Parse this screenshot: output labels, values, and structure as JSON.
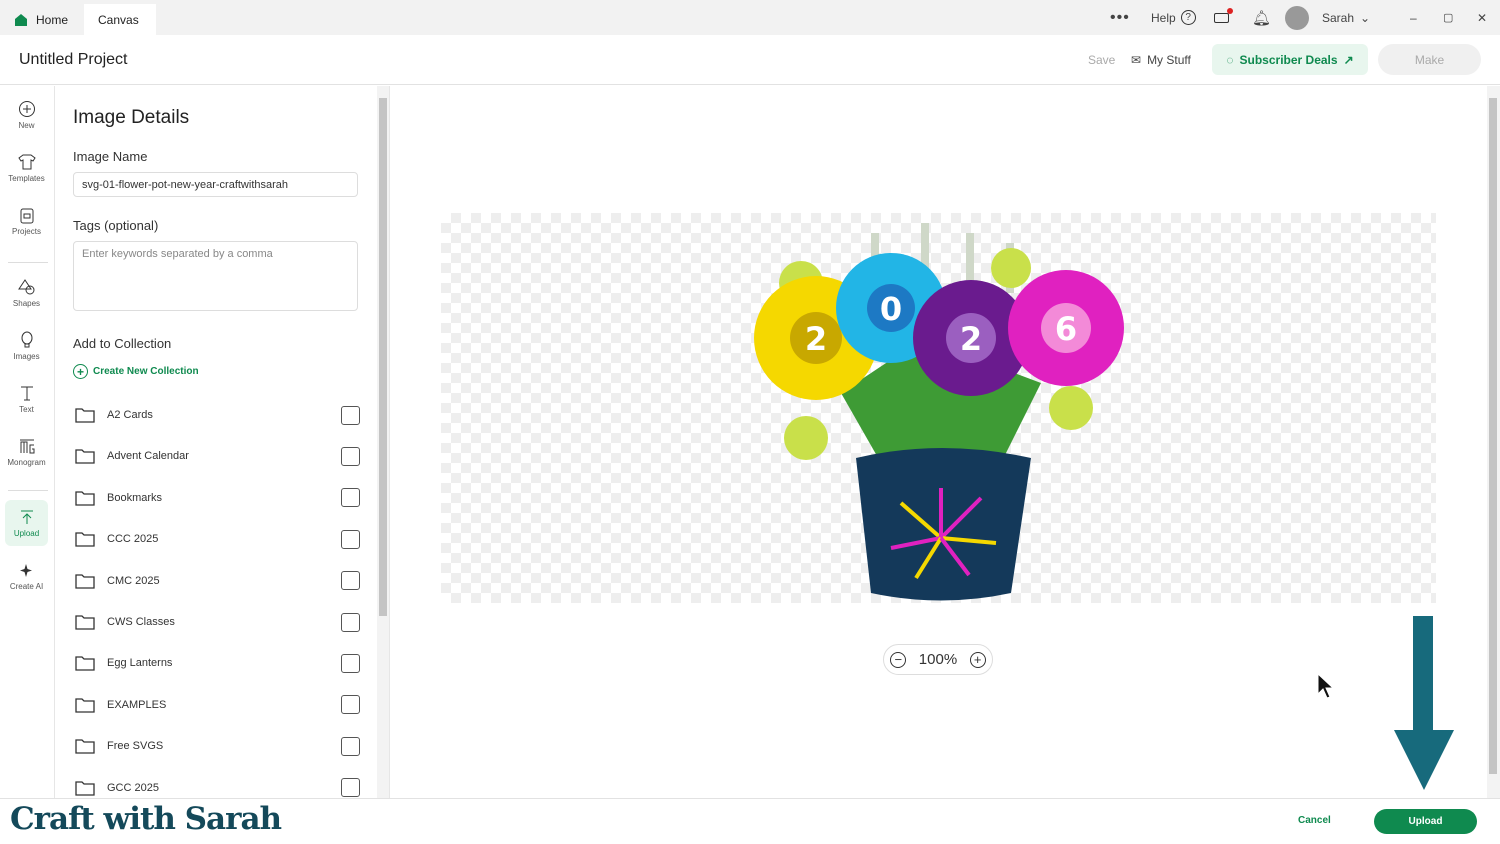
{
  "topbar": {
    "tabs": [
      {
        "label": "Home"
      },
      {
        "label": "Canvas"
      }
    ],
    "help": "Help",
    "user": "Sarah"
  },
  "header": {
    "title": "Untitled Project",
    "save": "Save",
    "my_stuff": "My Stuff",
    "subscriber_deals": "Subscriber Deals",
    "make": "Make"
  },
  "rail": [
    {
      "label": "New"
    },
    {
      "label": "Templates"
    },
    {
      "label": "Projects"
    },
    {
      "label": "Shapes"
    },
    {
      "label": "Images"
    },
    {
      "label": "Text"
    },
    {
      "label": "Monogram"
    },
    {
      "label": "Upload"
    },
    {
      "label": "Create AI"
    }
  ],
  "panel": {
    "title": "Image Details",
    "name_label": "Image Name",
    "name_value": "svg-01-flower-pot-new-year-craftwithsarah",
    "tags_label": "Tags (optional)",
    "tags_placeholder": "Enter keywords separated by a comma",
    "collection_label": "Add to Collection",
    "create_collection": "Create New Collection",
    "collections": [
      {
        "name": "A2 Cards"
      },
      {
        "name": "Advent Calendar"
      },
      {
        "name": "Bookmarks"
      },
      {
        "name": "CCC 2025"
      },
      {
        "name": "CMC 2025"
      },
      {
        "name": "CWS Classes"
      },
      {
        "name": "Egg Lanterns"
      },
      {
        "name": "EXAMPLES"
      },
      {
        "name": "Free SVGS"
      },
      {
        "name": "GCC 2025"
      }
    ]
  },
  "canvas": {
    "zoom": "100%",
    "flower_digits": [
      "2",
      "0",
      "2",
      "6"
    ]
  },
  "footer": {
    "cancel": "Cancel",
    "upload": "Upload"
  },
  "watermark": "Craft with Sarah",
  "colors": {
    "brand": "#0f8a4f",
    "arrow": "#176a7c"
  }
}
